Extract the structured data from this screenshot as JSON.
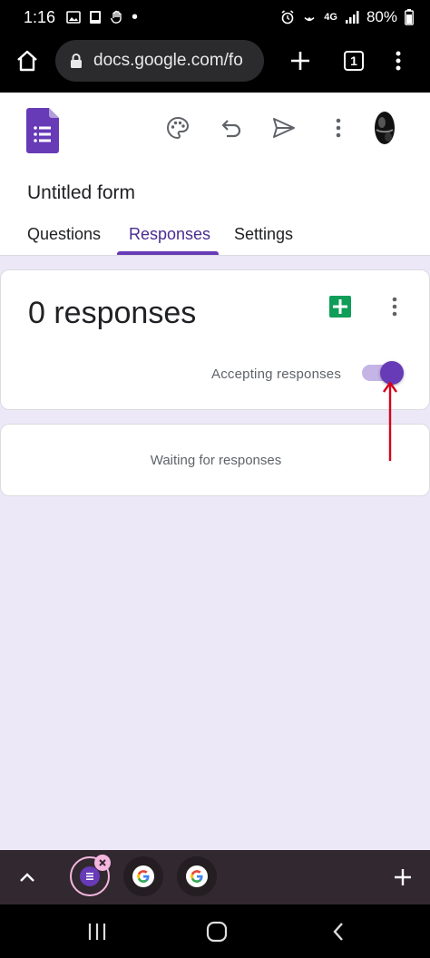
{
  "status_bar": {
    "time": "1:16",
    "network": "4G",
    "battery": "80%"
  },
  "browser": {
    "url": "docs.google.com/fo",
    "tab_count": "1",
    "icons": [
      "home-icon",
      "lock-icon",
      "new-tab-icon",
      "tab-switcher-icon",
      "browser-menu-icon"
    ]
  },
  "form": {
    "title": "Untitled form",
    "tabs": [
      {
        "label": "Questions"
      },
      {
        "label": "Responses"
      },
      {
        "label": "Settings"
      }
    ],
    "active_tab": "Responses",
    "toolbar_icons": [
      "palette-icon",
      "undo-icon",
      "send-icon",
      "more-vert-icon"
    ]
  },
  "responses": {
    "count_label": "0 responses",
    "accepting_label": "Accepting responses",
    "accepting_on": true,
    "waiting_label": "Waiting for responses"
  },
  "tab_strip": {
    "tabs": [
      "Google Forms",
      "Google",
      "Google"
    ]
  },
  "colors": {
    "brand_purple": "#673ab7",
    "page_background": "#ede8f7",
    "annotation_arrow": "#d6001c",
    "sheets_green": "#0f9d58"
  }
}
